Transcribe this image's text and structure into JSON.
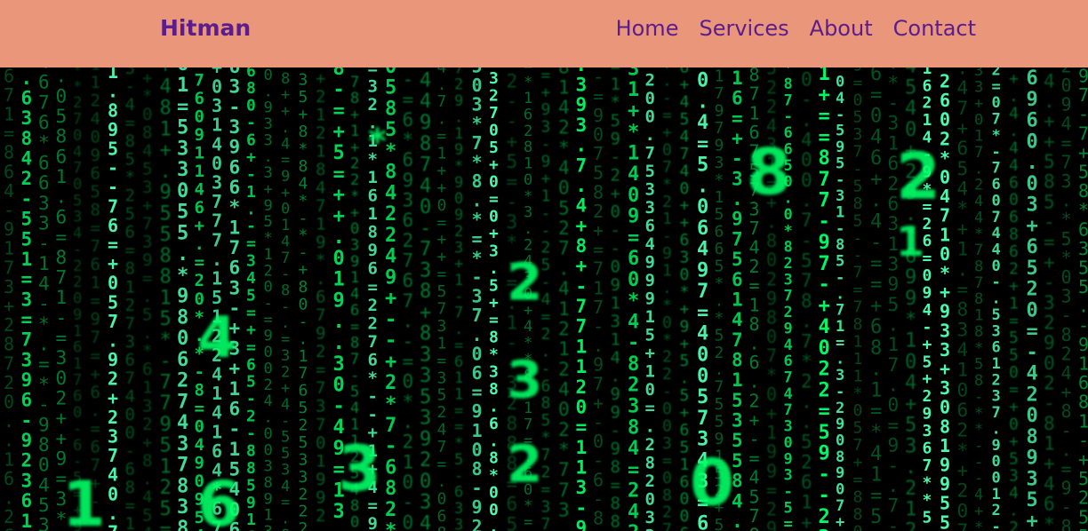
{
  "navbar": {
    "brand": "Hitman",
    "links": [
      {
        "label": "Home"
      },
      {
        "label": "Services"
      },
      {
        "label": "About"
      },
      {
        "label": "Contact"
      }
    ]
  },
  "hero": {
    "image": "matrix-digital-rain",
    "rain_color": "#00ff66",
    "large_glyphs": [
      "4",
      "3",
      "6",
      "1",
      "8",
      "2",
      "*",
      "2",
      "3",
      "2",
      "0",
      "1"
    ]
  },
  "colors": {
    "navbar_bg": "#e9967a",
    "nav_text": "#5b1d8c",
    "hero_bg": "#000000"
  }
}
